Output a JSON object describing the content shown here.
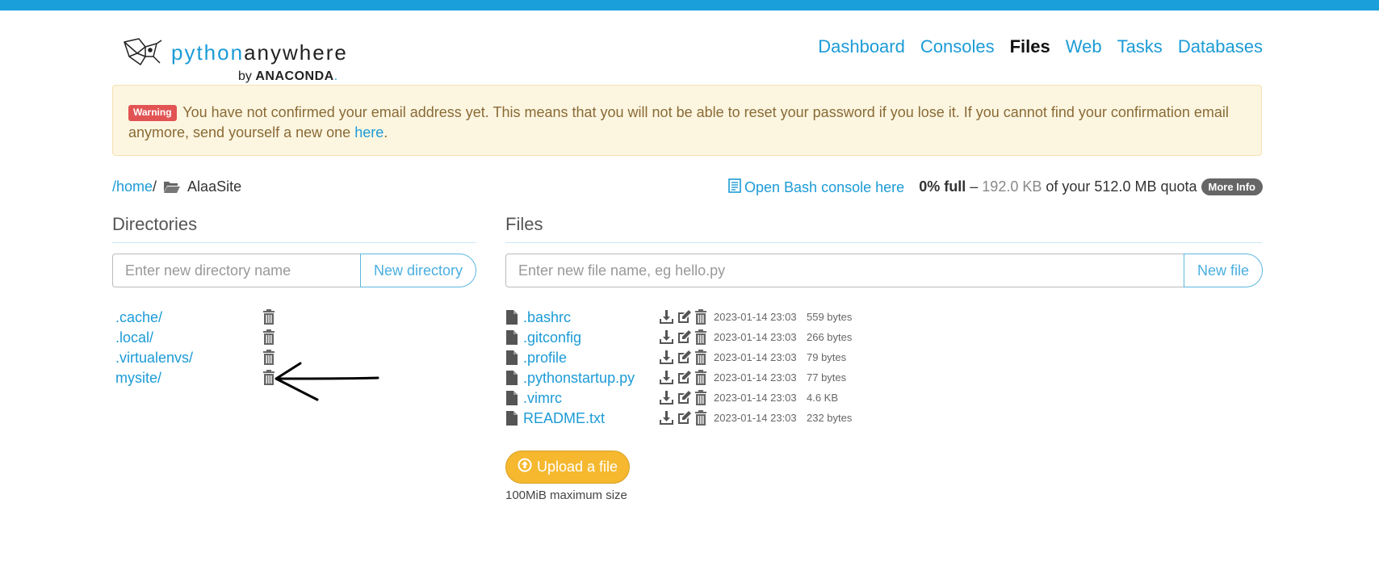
{
  "brand": {
    "word1": "python",
    "word2": "anywhere",
    "by": "by",
    "company": "ANACONDA",
    "company_suffix": "."
  },
  "nav": [
    {
      "label": "Dashboard",
      "active": false
    },
    {
      "label": "Consoles",
      "active": false
    },
    {
      "label": "Files",
      "active": true
    },
    {
      "label": "Web",
      "active": false
    },
    {
      "label": "Tasks",
      "active": false
    },
    {
      "label": "Databases",
      "active": false
    }
  ],
  "alert": {
    "badge": "Warning",
    "text": "You have not confirmed your email address yet. This means that you will not be able to reset your password if you lose it. If you cannot find your confirmation email anymore, send yourself a new one",
    "link": "here",
    "end": "."
  },
  "breadcrumb": {
    "root": "/home",
    "sep": "/",
    "current": "AlaaSite"
  },
  "bash_link": "Open Bash console here",
  "quota": {
    "percent": "0% full",
    "dash": "–",
    "used": "192.0 KB",
    "of_text": "of your 512.0 MB quota",
    "more": "More Info"
  },
  "directories": {
    "heading": "Directories",
    "placeholder": "Enter new directory name",
    "button": "New directory",
    "items": [
      ".cache/",
      ".local/",
      ".virtualenvs/",
      "mysite/"
    ]
  },
  "files": {
    "heading": "Files",
    "placeholder": "Enter new file name, eg hello.py",
    "button": "New file",
    "items": [
      {
        "name": ".bashrc",
        "date": "2023-01-14 23:03",
        "size": "559 bytes"
      },
      {
        "name": ".gitconfig",
        "date": "2023-01-14 23:03",
        "size": "266 bytes"
      },
      {
        "name": ".profile",
        "date": "2023-01-14 23:03",
        "size": "79 bytes"
      },
      {
        "name": ".pythonstartup.py",
        "date": "2023-01-14 23:03",
        "size": "77 bytes"
      },
      {
        "name": ".vimrc",
        "date": "2023-01-14 23:03",
        "size": "4.6 KB"
      },
      {
        "name": "README.txt",
        "date": "2023-01-14 23:03",
        "size": "232 bytes"
      }
    ]
  },
  "upload": {
    "label": "Upload a file",
    "note": "100MiB maximum size"
  },
  "colors": {
    "accent": "#1c9bd6",
    "topbar": "#1a9fdb",
    "upload": "#f5b82e",
    "warning_bg": "#fcf6e1",
    "badge": "#e25454"
  },
  "icons": [
    "logo-icon",
    "folder-icon",
    "terminal-icon",
    "trash-icon",
    "file-icon",
    "download-icon",
    "edit-icon",
    "upload-icon",
    "arrow-annotation"
  ]
}
